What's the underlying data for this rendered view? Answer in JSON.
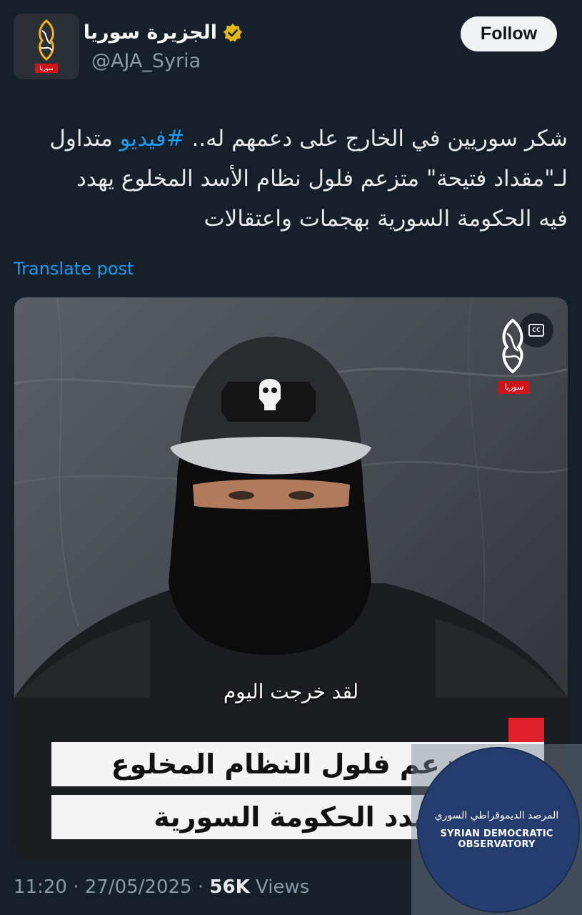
{
  "account": {
    "display_name": "الجزيرة سوريا",
    "handle": "@AJA_Syria",
    "avatar_tag": "سوريا",
    "follow_label": "Follow"
  },
  "post": {
    "text_line1_pre": "شكر سوريين في الخارج على دعمهم له.. ",
    "hashtag": "#فيديو",
    "text_line1_post": " متداول",
    "text_line2": "لـ\"مقداد فتيحة\" متزعم فلول نظام الأسد المخلوع يهدد",
    "text_line3": "فيه الحكومة السورية بهجمات واعتقالات",
    "translate_label": "Translate post"
  },
  "media": {
    "cc_label": "CC",
    "watermark_tag": "سوريا",
    "subtitle": "لقد خرجت اليوم",
    "lower_third_1": "متزعم فلول النظام المخلوع",
    "lower_third_2": "يهدد الحكومة السورية"
  },
  "meta": {
    "time": "11:20",
    "date": "27/05/2025",
    "views_count": "56K",
    "views_label": "Views"
  },
  "overlay": {
    "arabic": "المرصد الديموقراطي السوري",
    "english": "SYRIAN DEMOCRATIC OBSERVATORY"
  },
  "colors": {
    "background": "#15202b",
    "accent": "#1d9bf0",
    "brand_red": "#d0121b",
    "verified_gold": "#e2b719"
  },
  "icons": [
    "aljazeera-logo-icon",
    "verified-badge-icon",
    "closed-captions-icon"
  ]
}
